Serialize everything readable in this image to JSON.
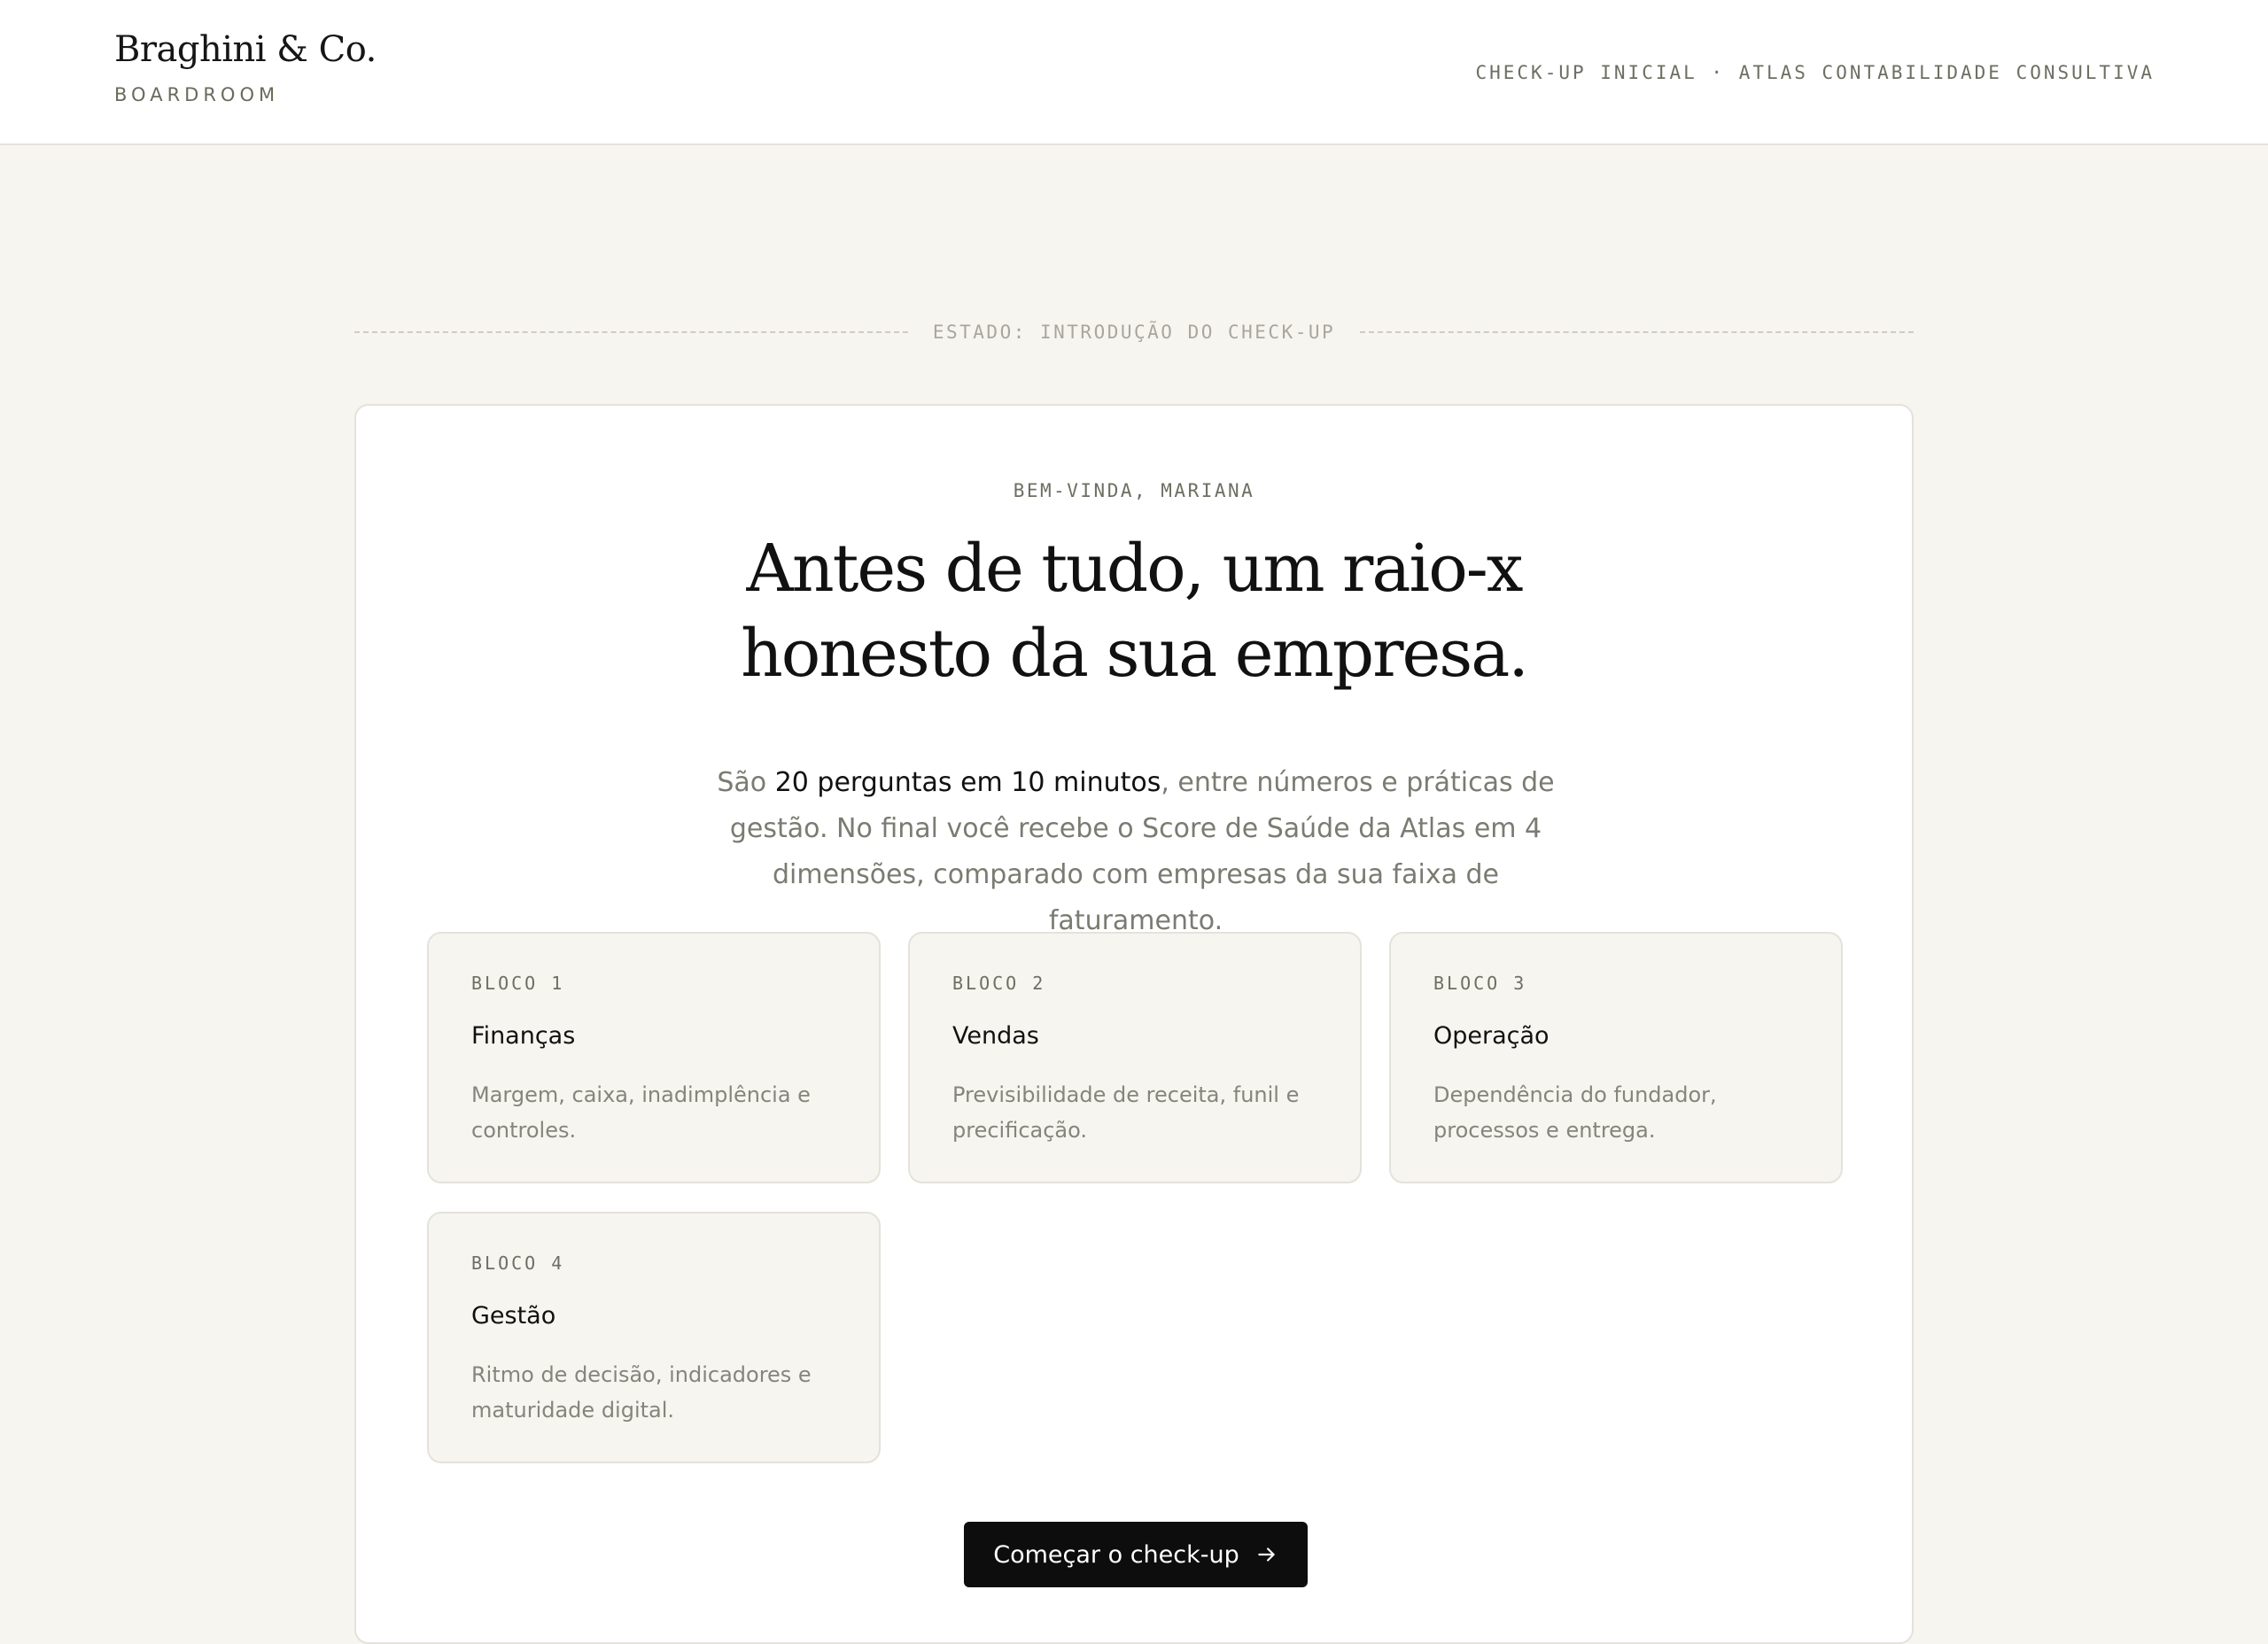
{
  "header": {
    "brand_name": "Braghini & Co.",
    "brand_sub": "BOARDROOM",
    "meta": "CHECK-UP INICIAL · ATLAS CONTABILIDADE CONSULTIVA"
  },
  "status": {
    "text": "ESTADO: INTRODUÇÃO DO CHECK-UP"
  },
  "intro": {
    "greeting": "BEM-VINDA, MARIANA",
    "headline_line1": "Antes de tudo, um raio-x",
    "headline_line2": "honesto da sua empresa.",
    "desc_prefix": "São ",
    "desc_emphasis": "20 perguntas em 10 minutos",
    "desc_suffix": ", entre números e práticas de gestão. No final você recebe o Score de Saúde da Atlas em 4 dimensões, comparado com empresas da sua faixa de faturamento."
  },
  "blocks": [
    {
      "label": "BLOCO 1",
      "title": "Finanças",
      "description": "Margem, caixa, inadimplência e controles."
    },
    {
      "label": "BLOCO 2",
      "title": "Vendas",
      "description": "Previsibilidade de receita, funil e precificação."
    },
    {
      "label": "BLOCO 3",
      "title": "Operação",
      "description": "Dependência do fundador, processos e entrega."
    },
    {
      "label": "BLOCO 4",
      "title": "Gestão",
      "description": "Ritmo de decisão, indicadores e maturidade digital."
    }
  ],
  "cta": {
    "label": "Começar o check-up",
    "icon": "arrow-right-icon"
  },
  "colors": {
    "page_background": "#f6f5f0",
    "card_background": "#ffffff",
    "button_background": "#0d0d0d",
    "muted_text": "#7b7b72"
  }
}
